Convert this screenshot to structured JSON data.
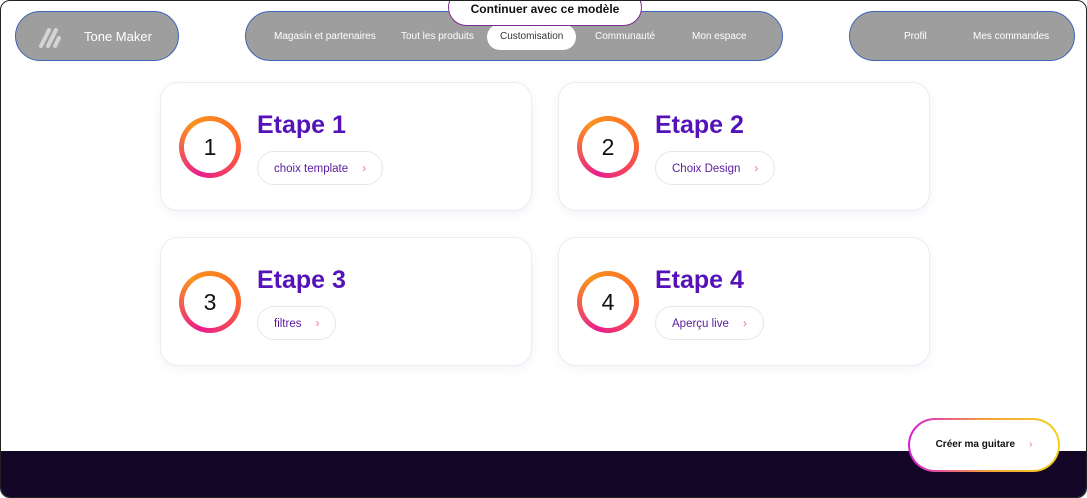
{
  "brand": {
    "name": "Tone Maker",
    "logo_icon": "guitar-strings-logo"
  },
  "nav": {
    "items": [
      {
        "label": "Magasin et partenaires"
      },
      {
        "label": "Tout les produits"
      },
      {
        "label": "Customisation",
        "active": true
      },
      {
        "label": "Communauté"
      },
      {
        "label": "Mon espace"
      }
    ]
  },
  "user_menu": {
    "items": [
      {
        "label": "Profil"
      },
      {
        "label": "Mes commandes"
      }
    ]
  },
  "continue_button": "Continuer avec ce modèle",
  "steps": [
    {
      "number": "1",
      "title": "Etape 1",
      "action": "choix template"
    },
    {
      "number": "2",
      "title": "Etape 2",
      "action": "Choix Design"
    },
    {
      "number": "3",
      "title": "Etape 3",
      "action": "filtres"
    },
    {
      "number": "4",
      "title": "Etape 4",
      "action": "Aperçu live"
    }
  ],
  "create_button": "Créer ma guitare",
  "icons": {
    "chevron": "chevron-right-icon"
  },
  "colors": {
    "accent": "#5512b8",
    "ring_start": "#e91e8c",
    "ring_end": "#f7931e",
    "footer": "#140626",
    "nav_bg": "#9e9e9e"
  }
}
